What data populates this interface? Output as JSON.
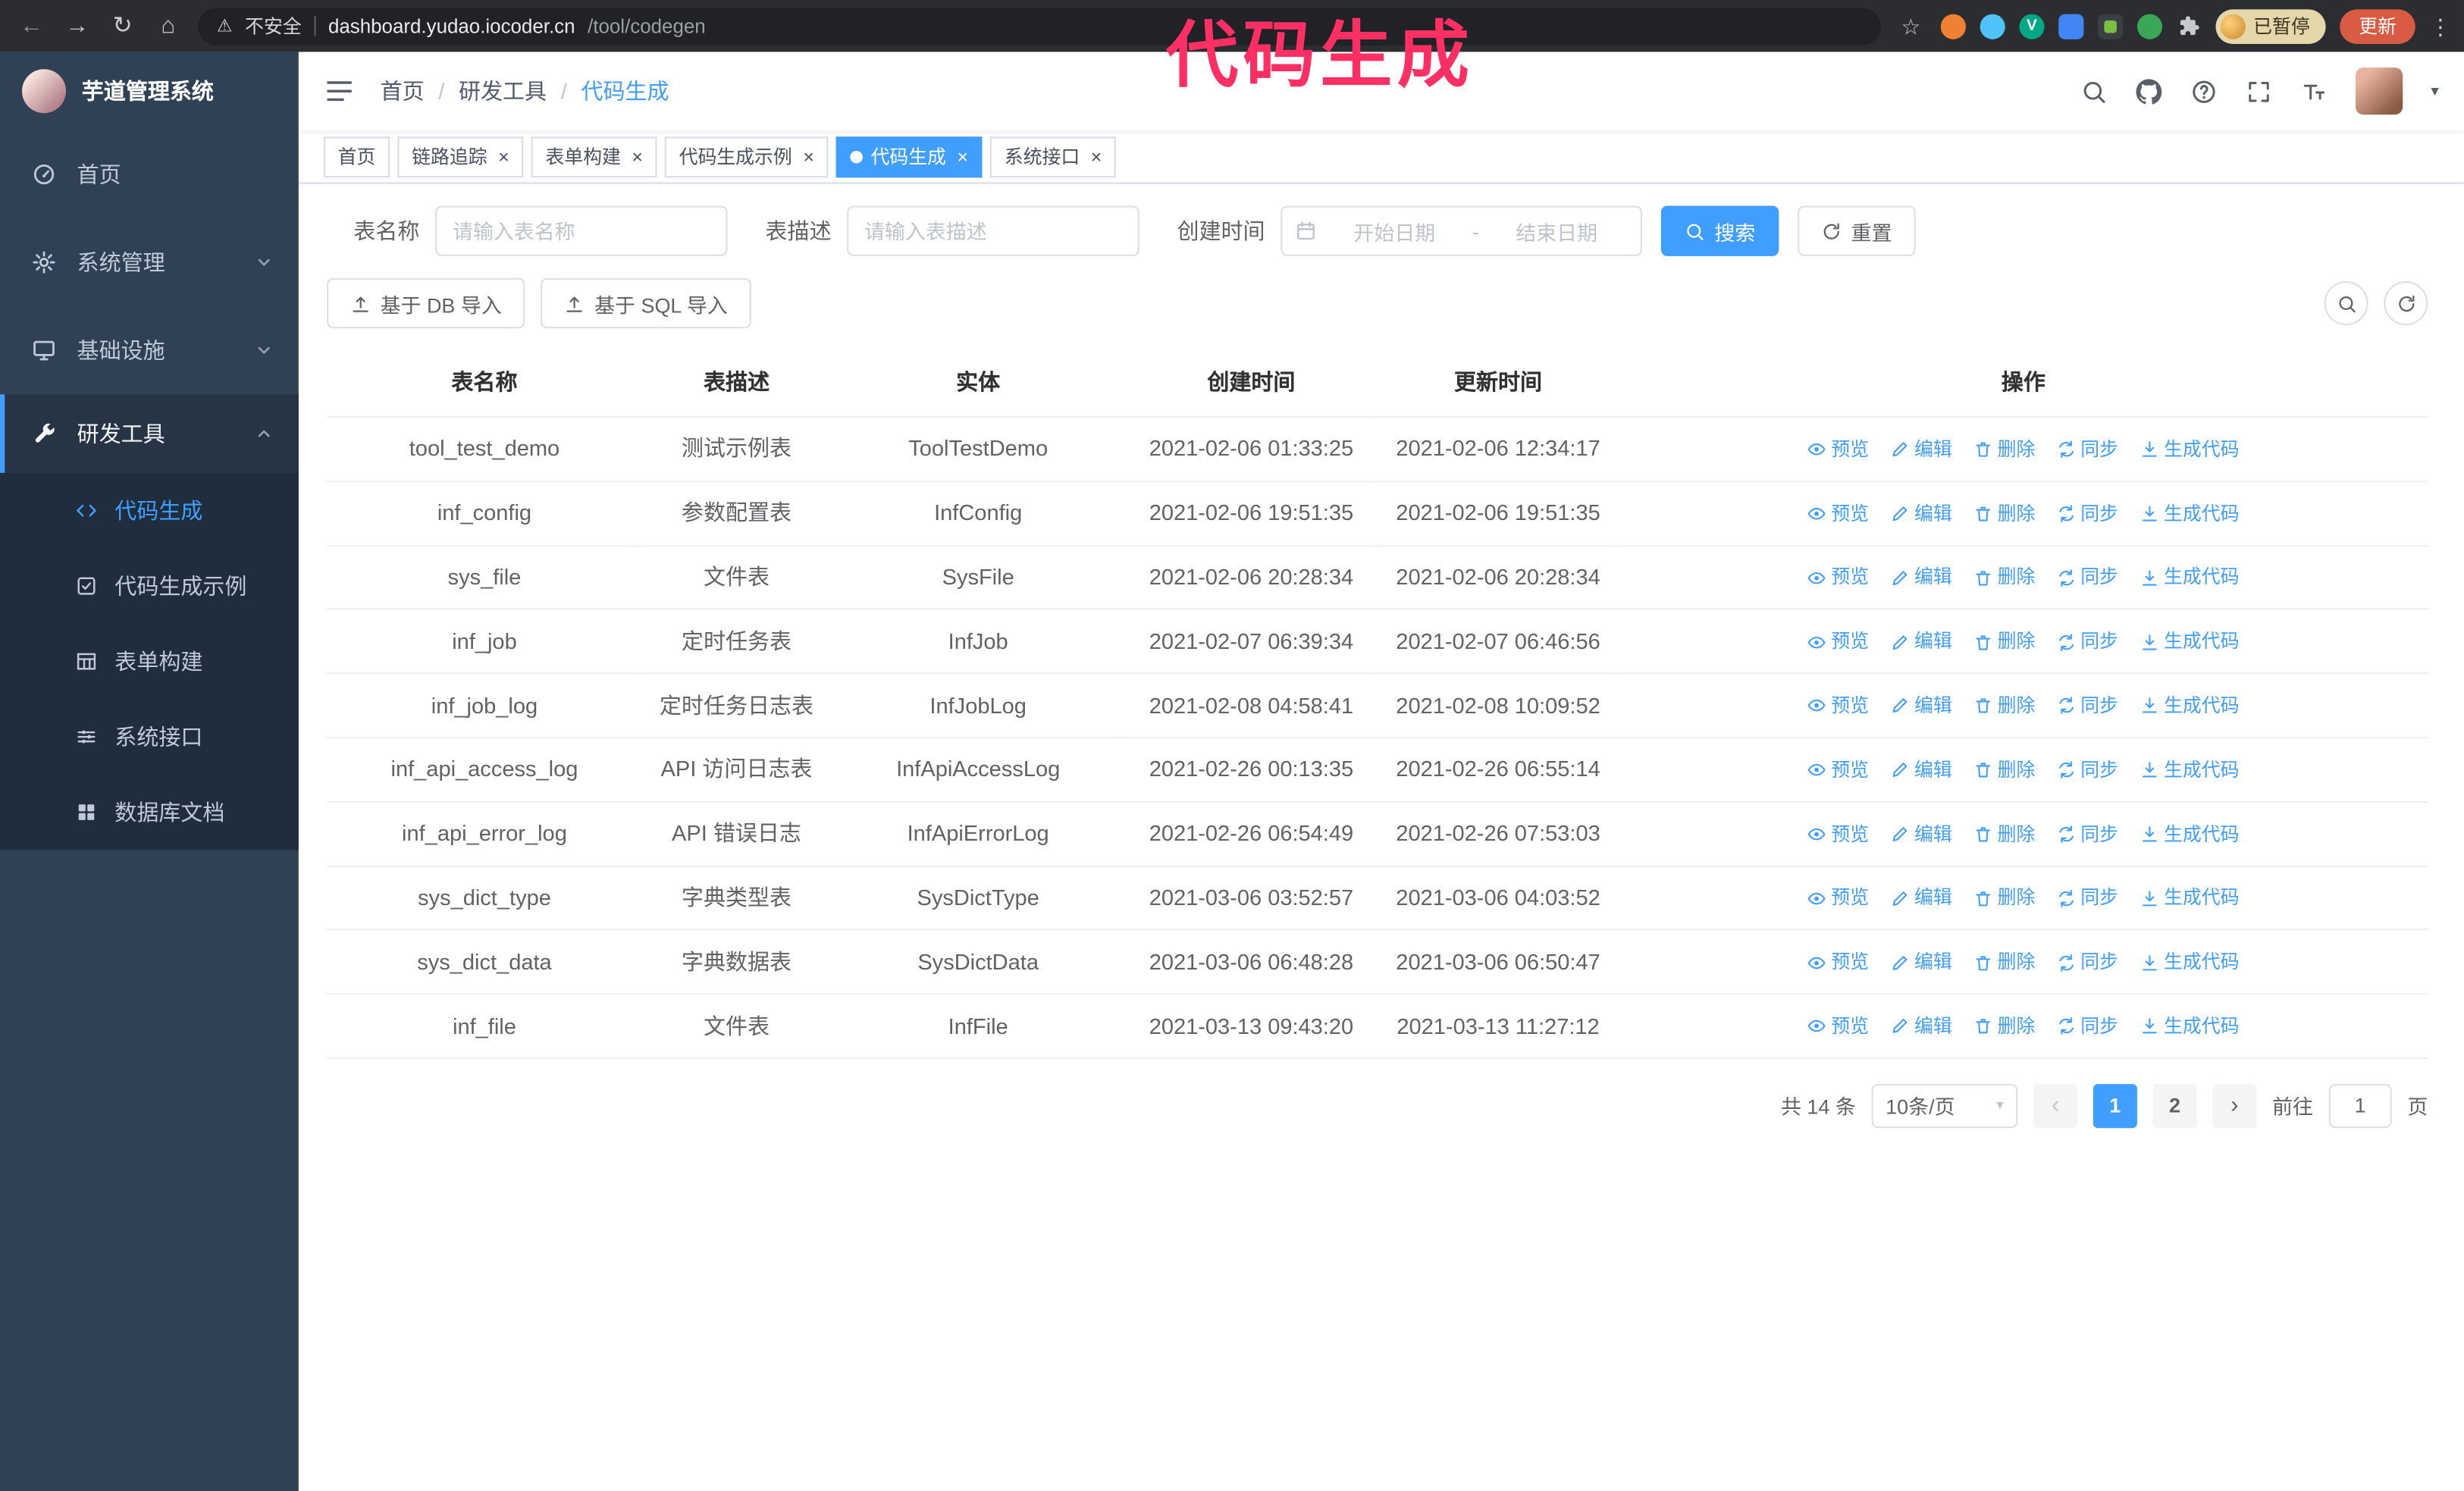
{
  "annotation": {
    "text": "代码生成"
  },
  "icons": {
    "close": "×",
    "star": "☆",
    "warning": "⚠",
    "back": "←",
    "forward": "→",
    "reload": "↻",
    "home": "⌂",
    "kebab": "⋮",
    "caret_down": "▾",
    "prev": "‹",
    "next": "›",
    "ext_check": "V"
  },
  "browser": {
    "security_label": "不安全",
    "url_host": "dashboard.yudao.iocoder.cn",
    "url_path": "/tool/codegen",
    "profile_badge": "已暂停",
    "update_label": "更新"
  },
  "sidebar": {
    "title": "芋道管理系统",
    "items": [
      {
        "label": "首页"
      },
      {
        "label": "系统管理"
      },
      {
        "label": "基础设施"
      },
      {
        "label": "研发工具"
      }
    ],
    "subitems": [
      {
        "label": "代码生成"
      },
      {
        "label": "代码生成示例"
      },
      {
        "label": "表单构建"
      },
      {
        "label": "系统接口"
      },
      {
        "label": "数据库文档"
      }
    ]
  },
  "breadcrumb": {
    "items": [
      "首页",
      "研发工具",
      "代码生成"
    ],
    "separator": "/"
  },
  "tabs": [
    {
      "label": "首页"
    },
    {
      "label": "链路追踪"
    },
    {
      "label": "表单构建"
    },
    {
      "label": "代码生成示例"
    },
    {
      "label": "代码生成"
    },
    {
      "label": "系统接口"
    }
  ],
  "filters": {
    "name_label": "表名称",
    "name_placeholder": "请输入表名称",
    "desc_label": "表描述",
    "desc_placeholder": "请输入表描述",
    "time_label": "创建时间",
    "start_placeholder": "开始日期",
    "range_separator": "-",
    "end_placeholder": "结束日期",
    "search_label": "搜索",
    "reset_label": "重置"
  },
  "toolbar": {
    "import_db_label": "基于 DB 导入",
    "import_sql_label": "基于 SQL 导入"
  },
  "table": {
    "columns": [
      "表名称",
      "表描述",
      "实体",
      "创建时间",
      "更新时间",
      "操作"
    ],
    "actions": [
      "预览",
      "编辑",
      "删除",
      "同步",
      "生成代码"
    ],
    "rows": [
      {
        "name": "tool_test_demo",
        "desc": "测试示例表",
        "entity": "ToolTestDemo",
        "created": "2021-02-06 01:33:25",
        "updated": "2021-02-06 12:34:17"
      },
      {
        "name": "inf_config",
        "desc": "参数配置表",
        "entity": "InfConfig",
        "created": "2021-02-06 19:51:35",
        "updated": "2021-02-06 19:51:35"
      },
      {
        "name": "sys_file",
        "desc": "文件表",
        "entity": "SysFile",
        "created": "2021-02-06 20:28:34",
        "updated": "2021-02-06 20:28:34"
      },
      {
        "name": "inf_job",
        "desc": "定时任务表",
        "entity": "InfJob",
        "created": "2021-02-07 06:39:34",
        "updated": "2021-02-07 06:46:56"
      },
      {
        "name": "inf_job_log",
        "desc": "定时任务日志表",
        "entity": "InfJobLog",
        "created": "2021-02-08 04:58:41",
        "updated": "2021-02-08 10:09:52"
      },
      {
        "name": "inf_api_access_log",
        "desc": "API 访问日志表",
        "entity": "InfApiAccessLog",
        "created": "2021-02-26 00:13:35",
        "updated": "2021-02-26 06:55:14"
      },
      {
        "name": "inf_api_error_log",
        "desc": "API 错误日志",
        "entity": "InfApiErrorLog",
        "created": "2021-02-26 06:54:49",
        "updated": "2021-02-26 07:53:03"
      },
      {
        "name": "sys_dict_type",
        "desc": "字典类型表",
        "entity": "SysDictType",
        "created": "2021-03-06 03:52:57",
        "updated": "2021-03-06 04:03:52"
      },
      {
        "name": "sys_dict_data",
        "desc": "字典数据表",
        "entity": "SysDictData",
        "created": "2021-03-06 06:48:28",
        "updated": "2021-03-06 06:50:47"
      },
      {
        "name": "inf_file",
        "desc": "文件表",
        "entity": "InfFile",
        "created": "2021-03-13 09:43:20",
        "updated": "2021-03-13 11:27:12"
      }
    ]
  },
  "pagination": {
    "total_label": "共 14 条",
    "page_size_label": "10条/页",
    "pages": [
      "1",
      "2"
    ],
    "goto_label": "前往",
    "goto_value": "1",
    "goto_unit": "页"
  }
}
